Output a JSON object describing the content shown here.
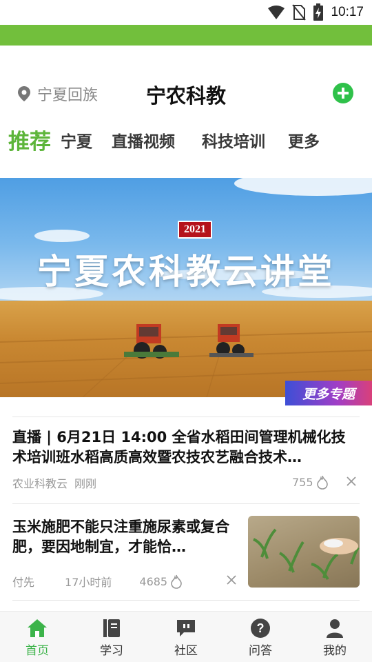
{
  "status_bar": {
    "time": "10:17"
  },
  "header": {
    "location": "宁夏回族",
    "title": "宁农科教"
  },
  "tabs": [
    {
      "label": "推荐",
      "active": true
    },
    {
      "label": "宁夏",
      "active": false
    },
    {
      "label": "直播视频",
      "active": false
    },
    {
      "label": "科技培训",
      "active": false
    },
    {
      "label": "更多",
      "active": false
    }
  ],
  "banner": {
    "year": "2021",
    "title": "宁夏农科教云讲堂",
    "more_topics": "更多专题"
  },
  "articles": [
    {
      "title": "直播 | 6月21日 14:00 全省水稻田间管理机械化技术培训班水稻高质高效暨农技农艺融合技术…",
      "source": "农业科教云",
      "time": "刚刚",
      "views": "755"
    },
    {
      "title": "玉米施肥不能只注重施尿素或复合肥，要因地制宜，才能恰…",
      "source": "付先",
      "time": "17小时前",
      "views": "4685"
    }
  ],
  "bottom_nav": [
    {
      "label": "首页",
      "active": true
    },
    {
      "label": "学习",
      "active": false
    },
    {
      "label": "社区",
      "active": false
    },
    {
      "label": "问答",
      "active": false
    },
    {
      "label": "我的",
      "active": false
    }
  ],
  "colors": {
    "brand_green": "#72bf3c",
    "tab_active": "#5db53a",
    "add_button": "#2fc14a",
    "nav_active": "#3cb34a"
  }
}
